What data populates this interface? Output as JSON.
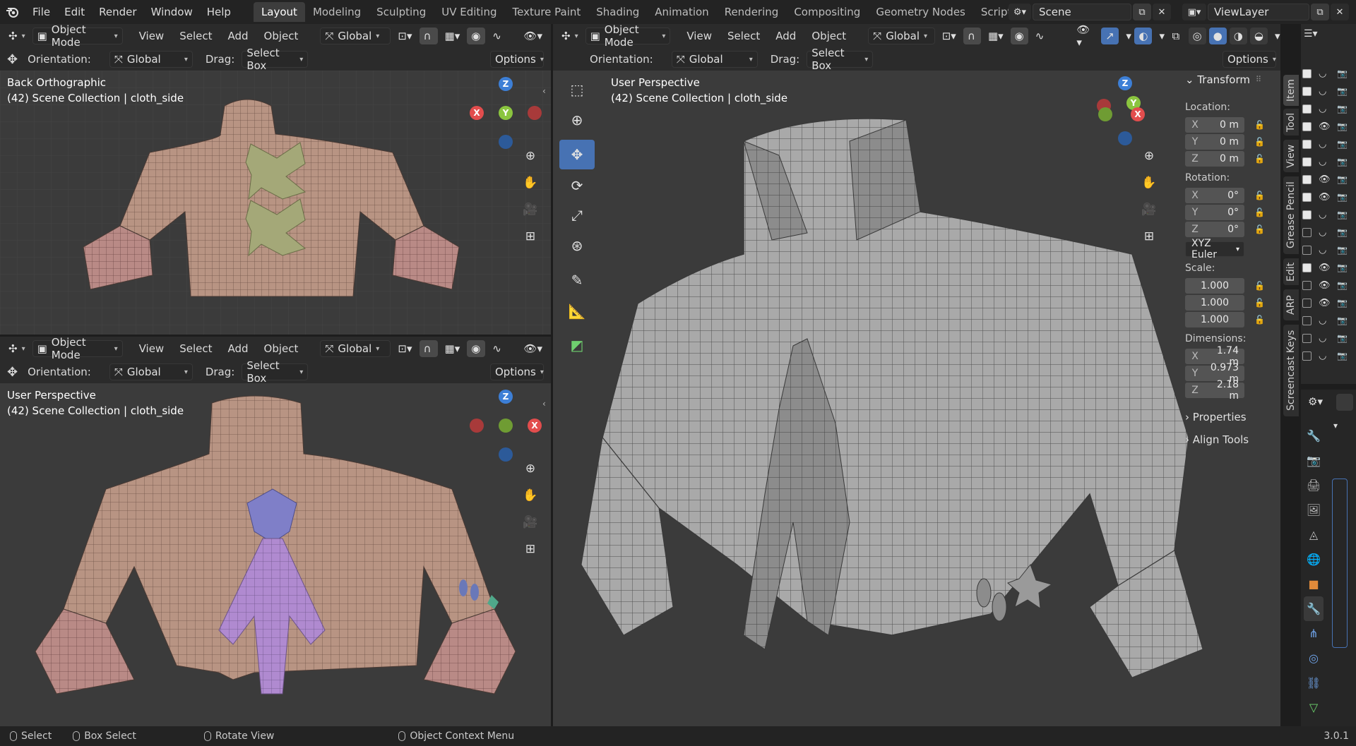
{
  "menu": [
    "File",
    "Edit",
    "Render",
    "Window",
    "Help"
  ],
  "workspaces": [
    "Layout",
    "Modeling",
    "Sculpting",
    "UV Editing",
    "Texture Paint",
    "Shading",
    "Animation",
    "Rendering",
    "Compositing",
    "Geometry Nodes",
    "Scripting"
  ],
  "active_workspace": "Layout",
  "scene": {
    "name": "Scene",
    "view_layer": "ViewLayer"
  },
  "header": {
    "mode": "Object Mode",
    "view": "View",
    "select": "Select",
    "add": "Add",
    "object": "Object",
    "transform_orientation": "Global",
    "orientation_label": "Orientation:",
    "orientation_value": "Global",
    "drag_label": "Drag:",
    "drag_value": "Select Box",
    "options": "Options"
  },
  "viewports": {
    "top_left": {
      "title": "Back Orthographic",
      "subtitle": "(42) Scene Collection | cloth_side"
    },
    "bottom_left": {
      "title": "User Perspective",
      "subtitle": "(42) Scene Collection | cloth_side"
    },
    "main": {
      "title": "User Perspective",
      "subtitle": "(42) Scene Collection | cloth_side"
    }
  },
  "gizmo": {
    "x": "X",
    "y": "Y",
    "z": "Z"
  },
  "npanel": {
    "section": "Transform",
    "location_label": "Location:",
    "location": [
      {
        "axis": "X",
        "value": "0 m"
      },
      {
        "axis": "Y",
        "value": "0 m"
      },
      {
        "axis": "Z",
        "value": "0 m"
      }
    ],
    "rotation_label": "Rotation:",
    "rotation": [
      {
        "axis": "X",
        "value": "0°"
      },
      {
        "axis": "Y",
        "value": "0°"
      },
      {
        "axis": "Z",
        "value": "0°"
      }
    ],
    "rotation_mode": "XYZ Euler",
    "scale_label": "Scale:",
    "scale": [
      "1.000",
      "1.000",
      "1.000"
    ],
    "dimensions_label": "Dimensions:",
    "dimensions": [
      {
        "axis": "X",
        "value": "1.74 m"
      },
      {
        "axis": "Y",
        "value": "0.973 m"
      },
      {
        "axis": "Z",
        "value": "2.18 m"
      }
    ],
    "properties": "Properties",
    "align_tools": "Align Tools"
  },
  "side_tabs": [
    "Item",
    "Tool",
    "View",
    "Grease Pencil",
    "Edit",
    "ARP",
    "Screencast Keys"
  ],
  "status": {
    "select": "Select",
    "box_select": "Box Select",
    "rotate_view": "Rotate View",
    "context_menu": "Object Context Menu",
    "version": "3.0.1"
  },
  "colors": {
    "accent": "#4772b3",
    "x_axis": "#e24d4d",
    "y_axis": "#8bc53f",
    "z_axis": "#3d7fd6",
    "cloth": "#b89483",
    "tie": "#b08ad0"
  }
}
